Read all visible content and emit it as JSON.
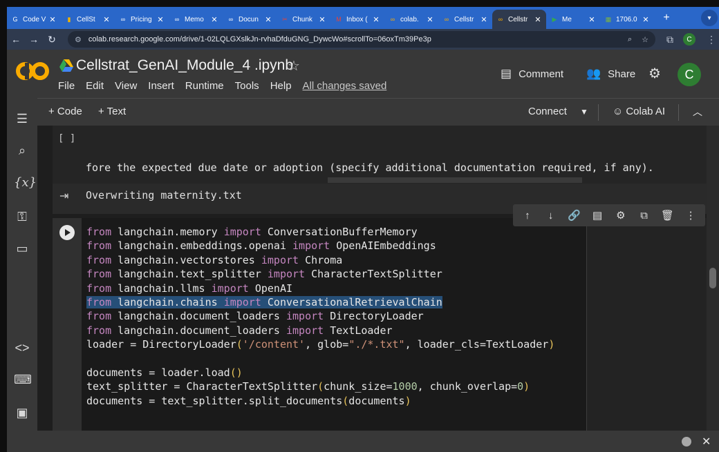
{
  "browser": {
    "tabs": [
      {
        "label": "Code V",
        "icon": "google-icon",
        "color": "#ffffff"
      },
      {
        "label": "CellSt",
        "icon": "slides-icon",
        "color": "#f4b400"
      },
      {
        "label": "Pricing",
        "icon": "openai-icon",
        "color": "#ffffff"
      },
      {
        "label": "Memo",
        "icon": "openai-icon",
        "color": "#ffffff"
      },
      {
        "label": "Docun",
        "icon": "openai-icon",
        "color": "#ffffff"
      },
      {
        "label": "Chunk",
        "icon": "tool-icon",
        "color": "#ea4335"
      },
      {
        "label": "Inbox (",
        "icon": "gmail-icon",
        "color": "#ea4335"
      },
      {
        "label": "colab.",
        "icon": "colab-icon",
        "color": "#f9ab00"
      },
      {
        "label": "Cellstr",
        "icon": "colab-icon",
        "color": "#f9ab00"
      },
      {
        "label": "Cellstr",
        "icon": "colab-icon",
        "color": "#f9ab00",
        "active": true
      },
      {
        "label": "Me",
        "icon": "meet-icon",
        "color": "#34a853"
      },
      {
        "label": "1706.0",
        "icon": "pdf-icon",
        "color": "#7cb342"
      }
    ],
    "url": "colab.research.google.com/drive/1-02LQLGXslkJn-rvhaDfduGNG_DywcWo#scrollTo=06oxTm39Pe3p",
    "profile_initial": "C"
  },
  "colab": {
    "notebook_title": "Cellstrat_GenAI_Module_4 .ipynb",
    "menu": [
      "File",
      "Edit",
      "View",
      "Insert",
      "Runtime",
      "Tools",
      "Help"
    ],
    "saved_status": "All changes saved",
    "comment_label": "Comment",
    "share_label": "Share",
    "avatar_initial": "C",
    "toolbar": {
      "add_code": "+ Code",
      "add_text": "+ Text",
      "connect": "Connect",
      "colab_ai": "Colab AI"
    }
  },
  "cells": {
    "cell1": {
      "bracket": "[ ]",
      "code_line": "fore the expected due date or adoption (specify additional documentation required, if any).",
      "output": "Overwriting maternity.txt"
    }
  }
}
